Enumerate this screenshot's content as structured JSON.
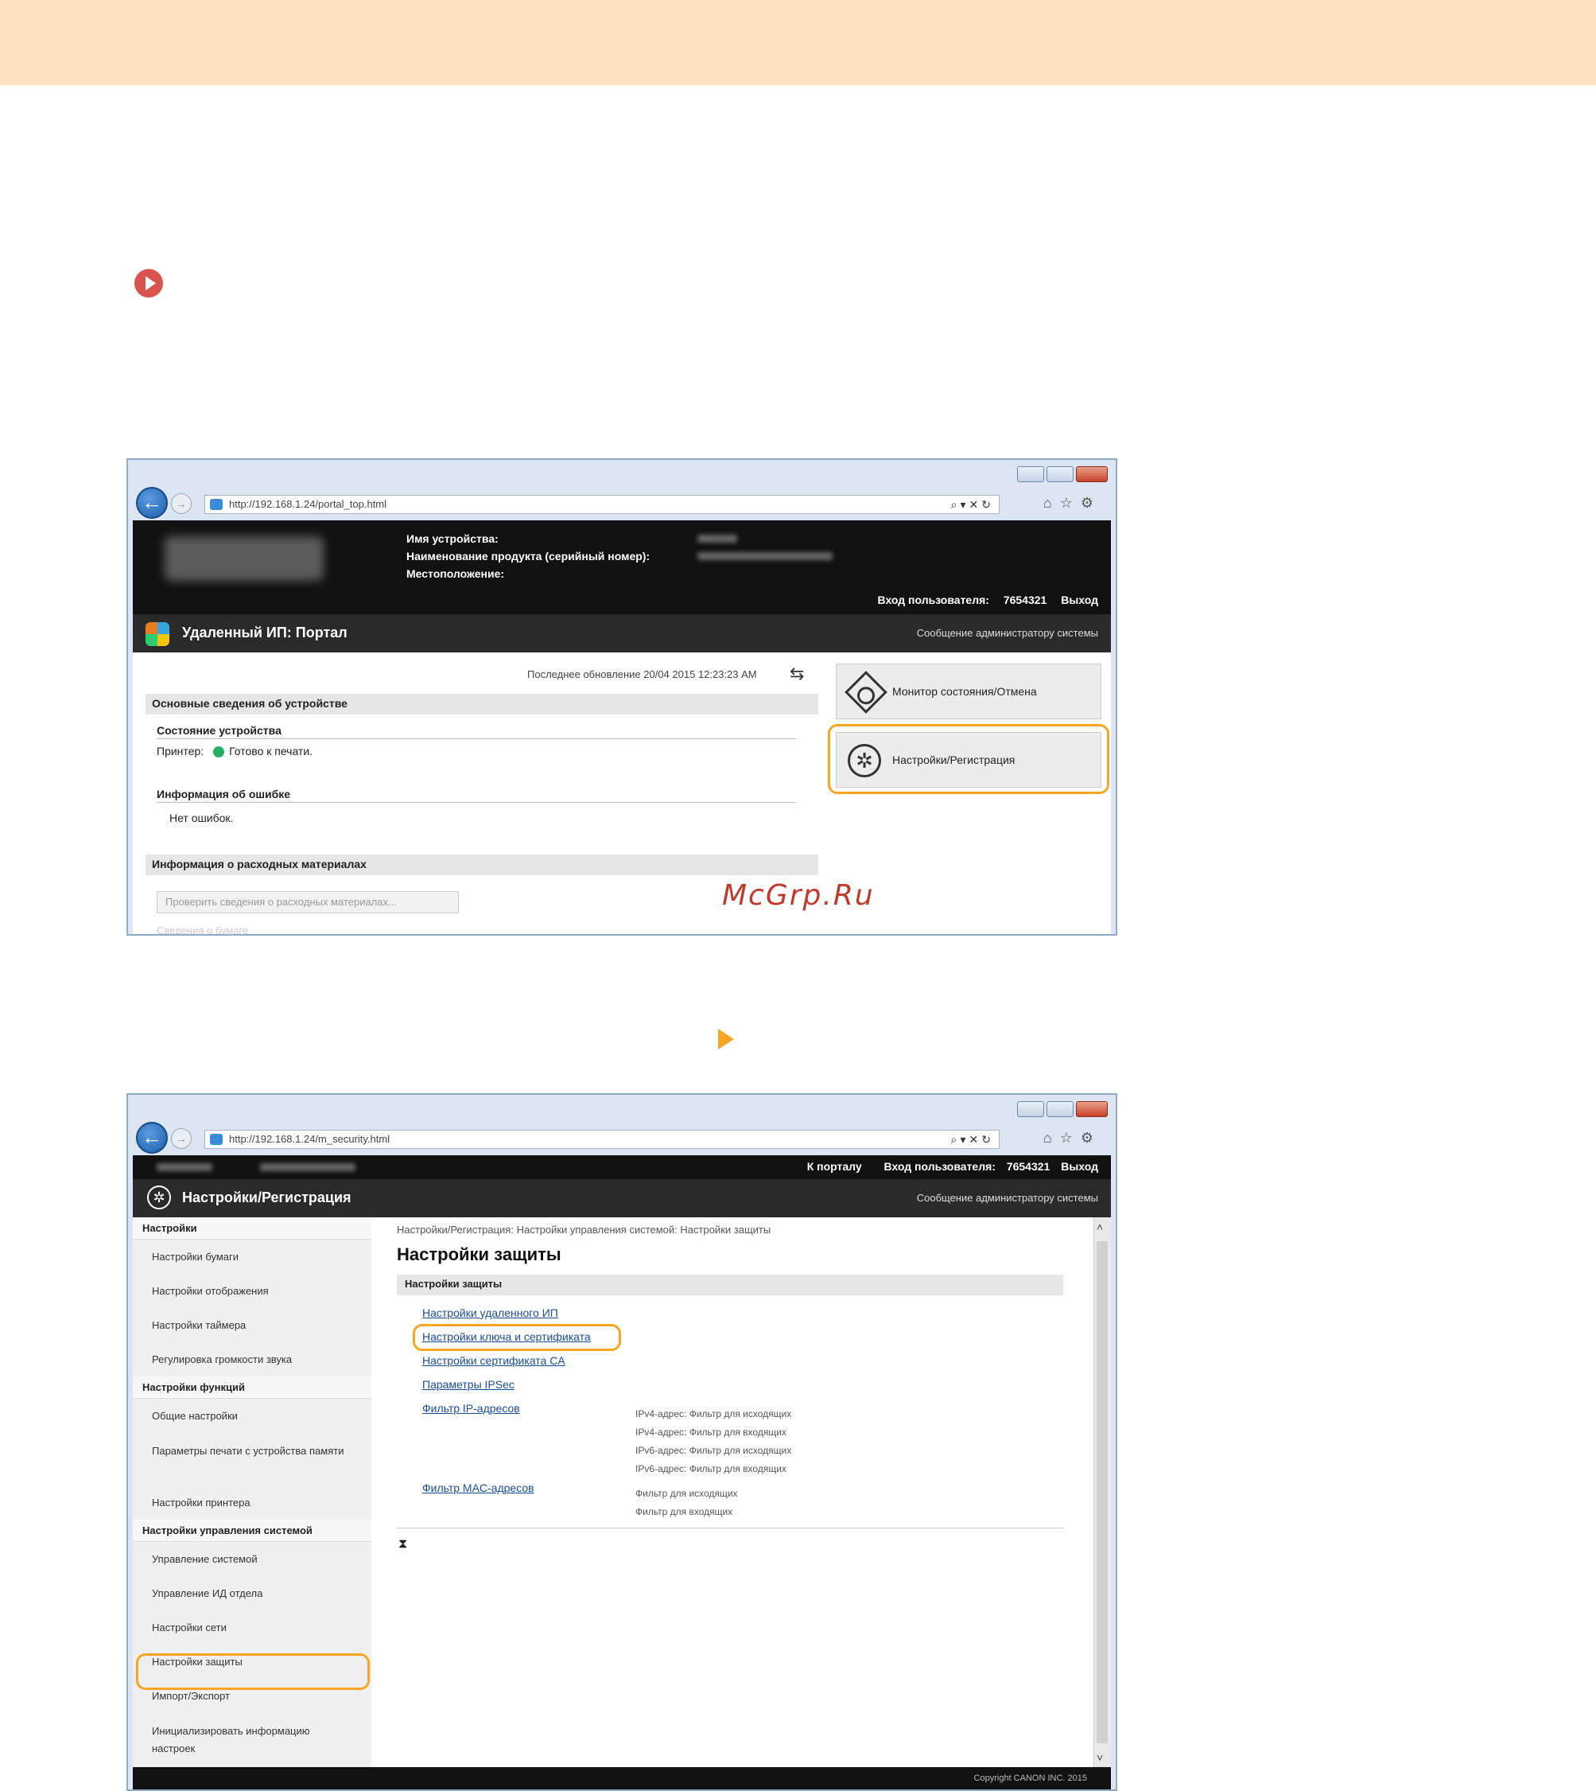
{
  "watermark": "McGrp.Ru",
  "window1": {
    "url": "http://192.168.1.24/portal_top.html",
    "header": {
      "device_name_label": "Имя устройства:",
      "product_name_label": "Наименование продукта (серийный номер):",
      "location_label": "Местоположение:",
      "login_label": "Вход пользователя:",
      "login_id": "7654321",
      "logout": "Выход"
    },
    "page_title": "Удаленный ИП: Портал",
    "admin_message": "Сообщение администратору системы",
    "last_updated": "Последнее обновление 20/04 2015 12:23:23 AM",
    "basic_info_title": "Основные сведения об устройстве",
    "device_status_title": "Состояние устройства",
    "printer_label": "Принтер:",
    "printer_status": "Готово к печати.",
    "error_info_title": "Информация об ошибке",
    "error_status": "Нет ошибок.",
    "consumables_title": "Информация о расходных материалах",
    "check_consumables_button": "Проверить сведения о расходных материалах...",
    "paper_info_faded": "Сведения о бумаге",
    "status_monitor_button": "Монитор состояния/Отмена",
    "settings_button": "Настройки/Регистрация"
  },
  "window2": {
    "url": "http://192.168.1.24/m_security.html",
    "to_portal": "К порталу",
    "login_label": "Вход пользователя:",
    "login_id": "7654321",
    "logout": "Выход",
    "page_title": "Настройки/Регистрация",
    "admin_message": "Сообщение администратору системы",
    "sidebar": {
      "section_settings": "Настройки",
      "paper_settings": "Настройки бумаги",
      "display_settings": "Настройки отображения",
      "timer_settings": "Настройки таймера",
      "volume_settings": "Регулировка громкости звука",
      "section_function": "Настройки функций",
      "general_settings": "Общие настройки",
      "memory_print": "Параметры печати с устройства памяти",
      "printer_settings": "Настройки принтера",
      "section_system": "Настройки управления системой",
      "system_management": "Управление системой",
      "dept_id": "Управление ИД отдела",
      "network_settings": "Настройки сети",
      "security_settings": "Настройки защиты",
      "import_export": "Импорт/Экспорт",
      "init_settings": "Инициализировать информацию настроек"
    },
    "breadcrumb": "Настройки/Регистрация: Настройки управления системой: Настройки защиты",
    "heading": "Настройки защиты",
    "section_bar": "Настройки защиты",
    "links": {
      "remote_ui": "Настройки удаленного ИП",
      "key_cert": "Настройки ключа и сертификата",
      "ca_cert": "Настройки сертификата CA",
      "ipsec": "Параметры IPSec",
      "ip_filter": "Фильтр IP-адресов",
      "mac_filter": "Фильтр MAC-адресов"
    },
    "ip_filter_desc": {
      "l1": "IPv4-адрес: Фильтр для исходящих",
      "l2": "IPv4-адрес: Фильтр для входящих",
      "l3": "IPv6-адрес: Фильтр для исходящих",
      "l4": "IPv6-адрес: Фильтр для входящих"
    },
    "mac_filter_desc": {
      "l1": "Фильтр для исходящих",
      "l2": "Фильтр для входящих"
    },
    "to_top": "⧗",
    "copyright": "Copyright CANON INC. 2015"
  }
}
